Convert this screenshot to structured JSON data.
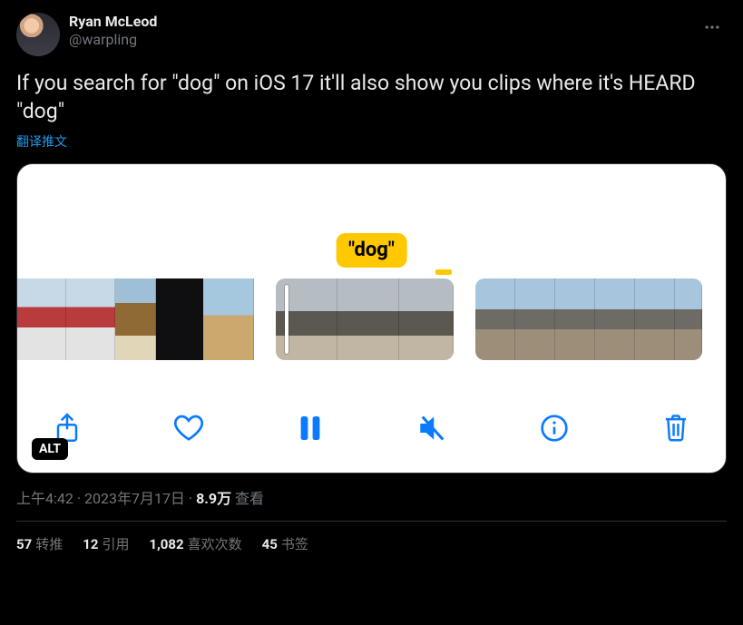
{
  "author": {
    "display_name": "Ryan McLeod",
    "handle": "@warpling"
  },
  "tweet_text": "If you search for \"dog\" on iOS 17 it'll also show you clips where it's HEARD \"dog\"",
  "translate_label": "翻译推文",
  "media": {
    "caption_text": "\"dog\"",
    "alt_badge": "ALT"
  },
  "meta": {
    "time": "上午4:42",
    "date": "2023年7月17日",
    "views_count": "8.9万",
    "views_label": "查看"
  },
  "stats": {
    "retweets_count": "57",
    "retweets_label": "转推",
    "quotes_count": "12",
    "quotes_label": "引用",
    "likes_count": "1,082",
    "likes_label": "喜欢次数",
    "bookmarks_count": "45",
    "bookmarks_label": "书签"
  }
}
